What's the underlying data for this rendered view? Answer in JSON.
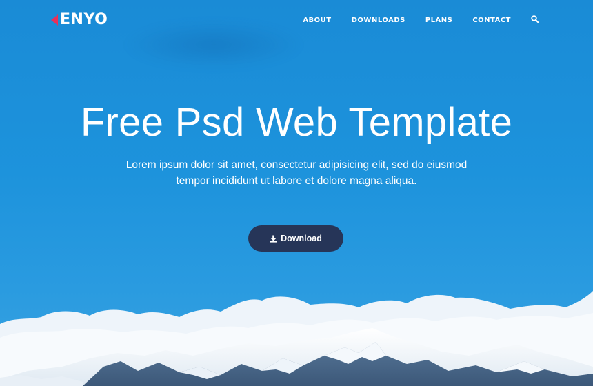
{
  "brand": {
    "name": "ENYO",
    "accent": "#e8305a"
  },
  "nav": {
    "items": [
      {
        "label": "ABOUT"
      },
      {
        "label": "DOWNLOADS"
      },
      {
        "label": "PLANS"
      },
      {
        "label": "CONTACT"
      }
    ],
    "search_icon": "search-icon"
  },
  "hero": {
    "title": "Free Psd Web Template",
    "subtitle": "Lorem ipsum dolor sit amet, consectetur adipisicing elit, sed do eiusmod tempor incididunt ut labore et dolore magna aliqua.",
    "button_label": "Download",
    "button_icon": "download-icon",
    "background_color": "#1b8fd9",
    "button_color": "#263558"
  }
}
